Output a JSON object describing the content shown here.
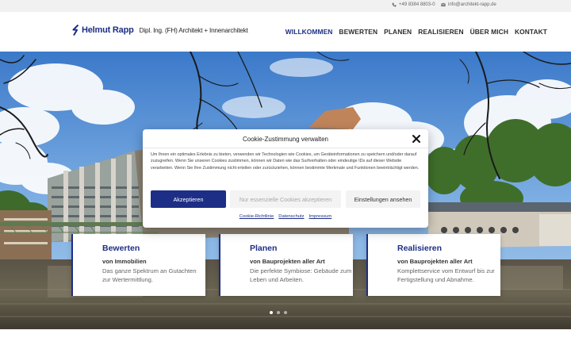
{
  "topbar": {
    "phone": "+49 8384 8803-0",
    "email": "info@architekt-rapp.de",
    "phone_icon": "phone-icon",
    "email_icon": "envelope-icon"
  },
  "brand": {
    "name": "Helmut Rapp",
    "tagline": "Dipl. Ing. (FH) Architekt + Innenarchitekt",
    "color": "#1d2e86"
  },
  "nav": {
    "items": [
      {
        "label": "WILLKOMMEN",
        "active": true
      },
      {
        "label": "BEWERTEN",
        "active": false
      },
      {
        "label": "PLANEN",
        "active": false
      },
      {
        "label": "REALISIEREN",
        "active": false
      },
      {
        "label": "ÜBER MICH",
        "active": false
      },
      {
        "label": "KONTAKT",
        "active": false
      }
    ]
  },
  "cards": [
    {
      "title": "Bewerten",
      "subtitle": "von Immobilien",
      "text": "Das ganze Spektrum an Gutachten zur Wertermittlung."
    },
    {
      "title": "Planen",
      "subtitle": "von Bauprojekten aller Art",
      "text": "Die perfekte Symbiose: Gebäude zum Leben und Arbeiten."
    },
    {
      "title": "Realisieren",
      "subtitle": "von Bauprojekten aller Art",
      "text": "Komplettservice vom Entwurf bis zur Fertigstellung und Abnahme."
    }
  ],
  "slider": {
    "count": 3,
    "active": 0
  },
  "cookie": {
    "title": "Cookie-Zustimmung verwalten",
    "body": "Um Ihnen ein optimales Erlebnis zu bieten, verwenden wir Technologien wie Cookies, um Geräteinformationen zu speichern und/oder darauf zuzugreifen. Wenn Sie unseren Cookies zustimmen, können wir Daten wie das Surfverhalten oder eindeutige IDs auf dieser Website verarbeiten. Wenn Sie Ihre Zustimmung nicht erteilen oder zurückziehen, können bestimmte Merkmale und Funktionen beeinträchtigt werden.",
    "accept_label": "Akzeptieren",
    "essential_label": "Nur essenzielle Cookies akzeptieren",
    "settings_label": "Einstellungen ansehen",
    "links": [
      "Cookie-Richtlinie",
      "Datenschutz",
      "Impressum"
    ],
    "close_icon": "close-icon"
  }
}
